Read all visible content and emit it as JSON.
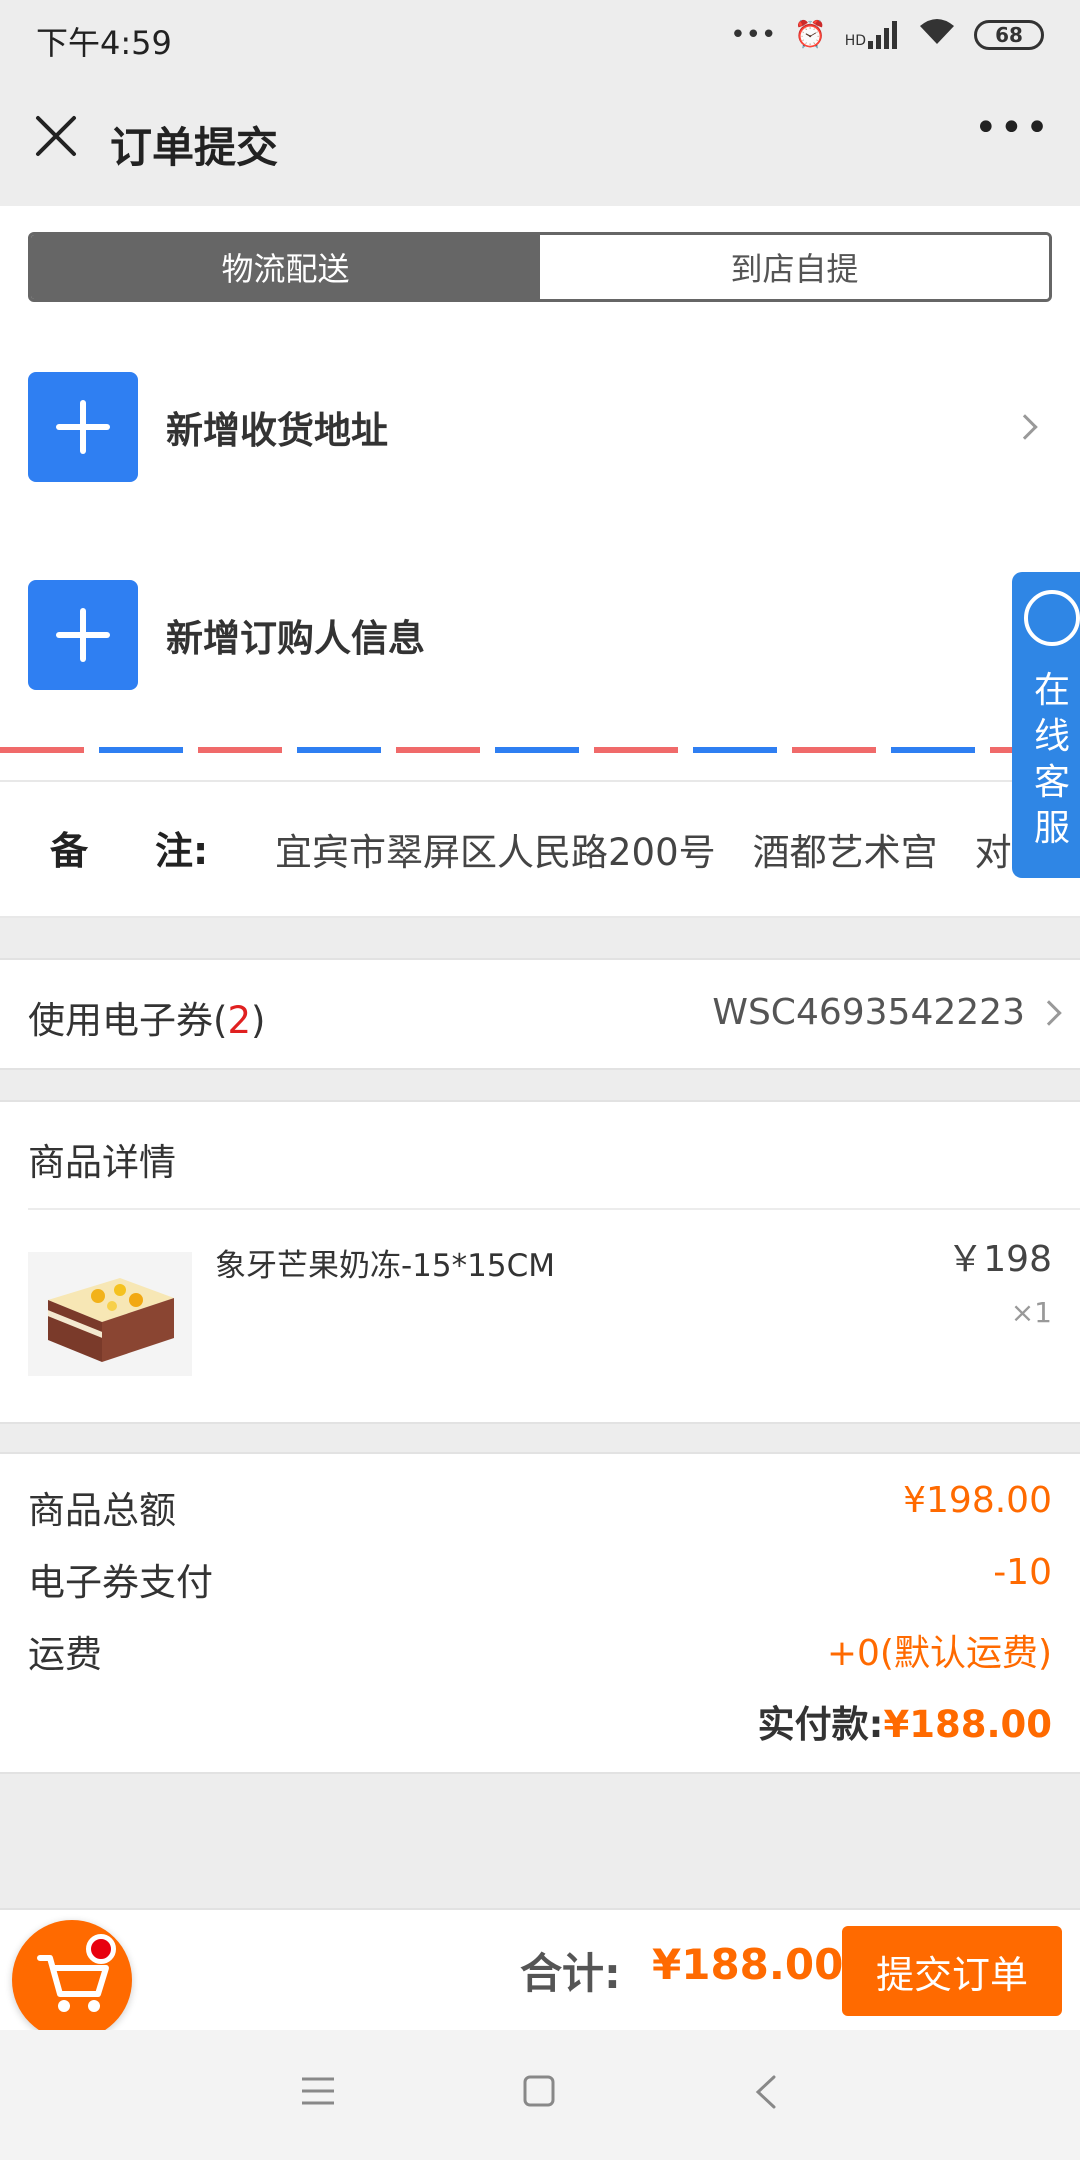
{
  "status_bar": {
    "time": "下午4:59",
    "signal_label": "HD",
    "battery": "68",
    "icons": [
      "more-dots-icon",
      "alarm-icon",
      "signal-icon",
      "wifi-icon",
      "battery-icon"
    ]
  },
  "nav": {
    "title": "订单提交",
    "close_icon": "close-icon",
    "more_icon": "more-icon"
  },
  "delivery_tabs": [
    {
      "label": "物流配送",
      "active": true
    },
    {
      "label": "到店自提",
      "active": false
    }
  ],
  "address": {
    "label": "新增收货地址"
  },
  "buyer": {
    "label": "新增订购人信息"
  },
  "memo": {
    "label_1": "备",
    "label_2": "注:",
    "text": "宜宾市翠屏区人民路200号　酒都艺术宫　对面"
  },
  "chat_float": {
    "text": "在线客服"
  },
  "coupon": {
    "label": "使用电子券(",
    "count": "2",
    "close": ")",
    "code": "WSC4693542223"
  },
  "goods": {
    "title": "商品详情",
    "items": [
      {
        "name": "象牙芒果奶冻-15*15CM",
        "price": "￥198",
        "qty": "×1"
      }
    ]
  },
  "totals": {
    "rows": [
      {
        "label": "商品总额",
        "value": "¥198.00"
      },
      {
        "label": "电子券支付",
        "value": "-10"
      },
      {
        "label": "运费",
        "value": "+0(默认运费)"
      }
    ],
    "pay_label": "实付款:",
    "pay_value": "¥188.00"
  },
  "action_bar": {
    "sum_label": "合计:",
    "sum_value": "¥188.00",
    "submit": "提交订单"
  },
  "colors": {
    "accent": "#ff6a00",
    "blue": "#2f7ff2",
    "red": "#e02020"
  }
}
